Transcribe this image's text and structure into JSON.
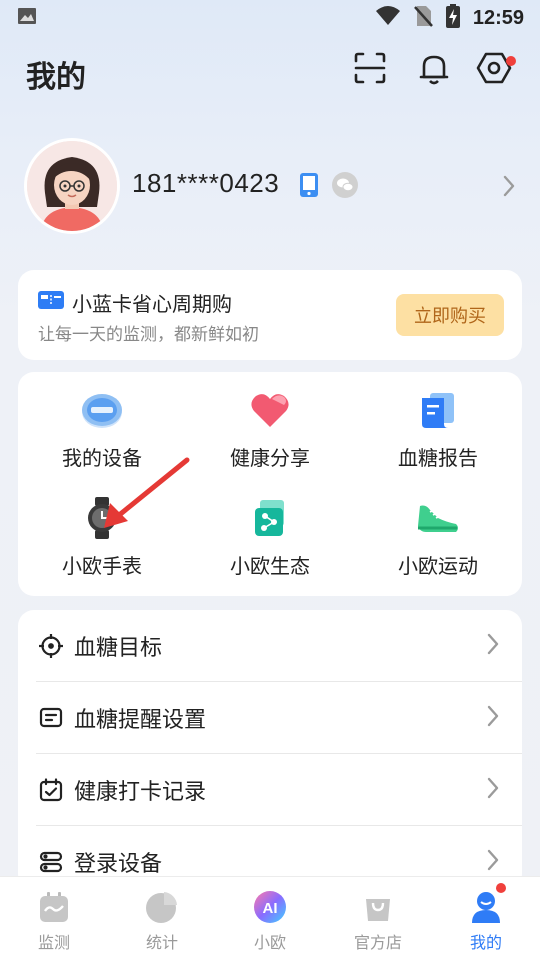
{
  "status": {
    "time": "12:59"
  },
  "header": {
    "title": "我的"
  },
  "profile": {
    "phone": "181****0423"
  },
  "promo": {
    "title": "小蓝卡省心周期购",
    "subtitle": "让每一天的监测，都新鲜如初",
    "button": "立即购买"
  },
  "grid": [
    {
      "label": "我的设备",
      "icon": "device-icon"
    },
    {
      "label": "健康分享",
      "icon": "heart-share-icon"
    },
    {
      "label": "血糖报告",
      "icon": "report-icon"
    },
    {
      "label": "小欧手表",
      "icon": "watch-icon"
    },
    {
      "label": "小欧生态",
      "icon": "ecosystem-icon"
    },
    {
      "label": "小欧运动",
      "icon": "sneaker-icon"
    }
  ],
  "list": [
    {
      "label": "血糖目标",
      "icon": "target-icon"
    },
    {
      "label": "血糖提醒设置",
      "icon": "message-icon"
    },
    {
      "label": "健康打卡记录",
      "icon": "calendar-check-icon"
    },
    {
      "label": "登录设备",
      "icon": "devices-icon"
    }
  ],
  "nav": [
    {
      "label": "监测"
    },
    {
      "label": "统计"
    },
    {
      "label": "小欧",
      "badge": "AI"
    },
    {
      "label": "官方店"
    },
    {
      "label": "我的"
    }
  ],
  "colors": {
    "accent": "#2f7cf6",
    "badge": "#f0403c",
    "buy_bg": "#fde0a3",
    "buy_text": "#b0661a"
  }
}
